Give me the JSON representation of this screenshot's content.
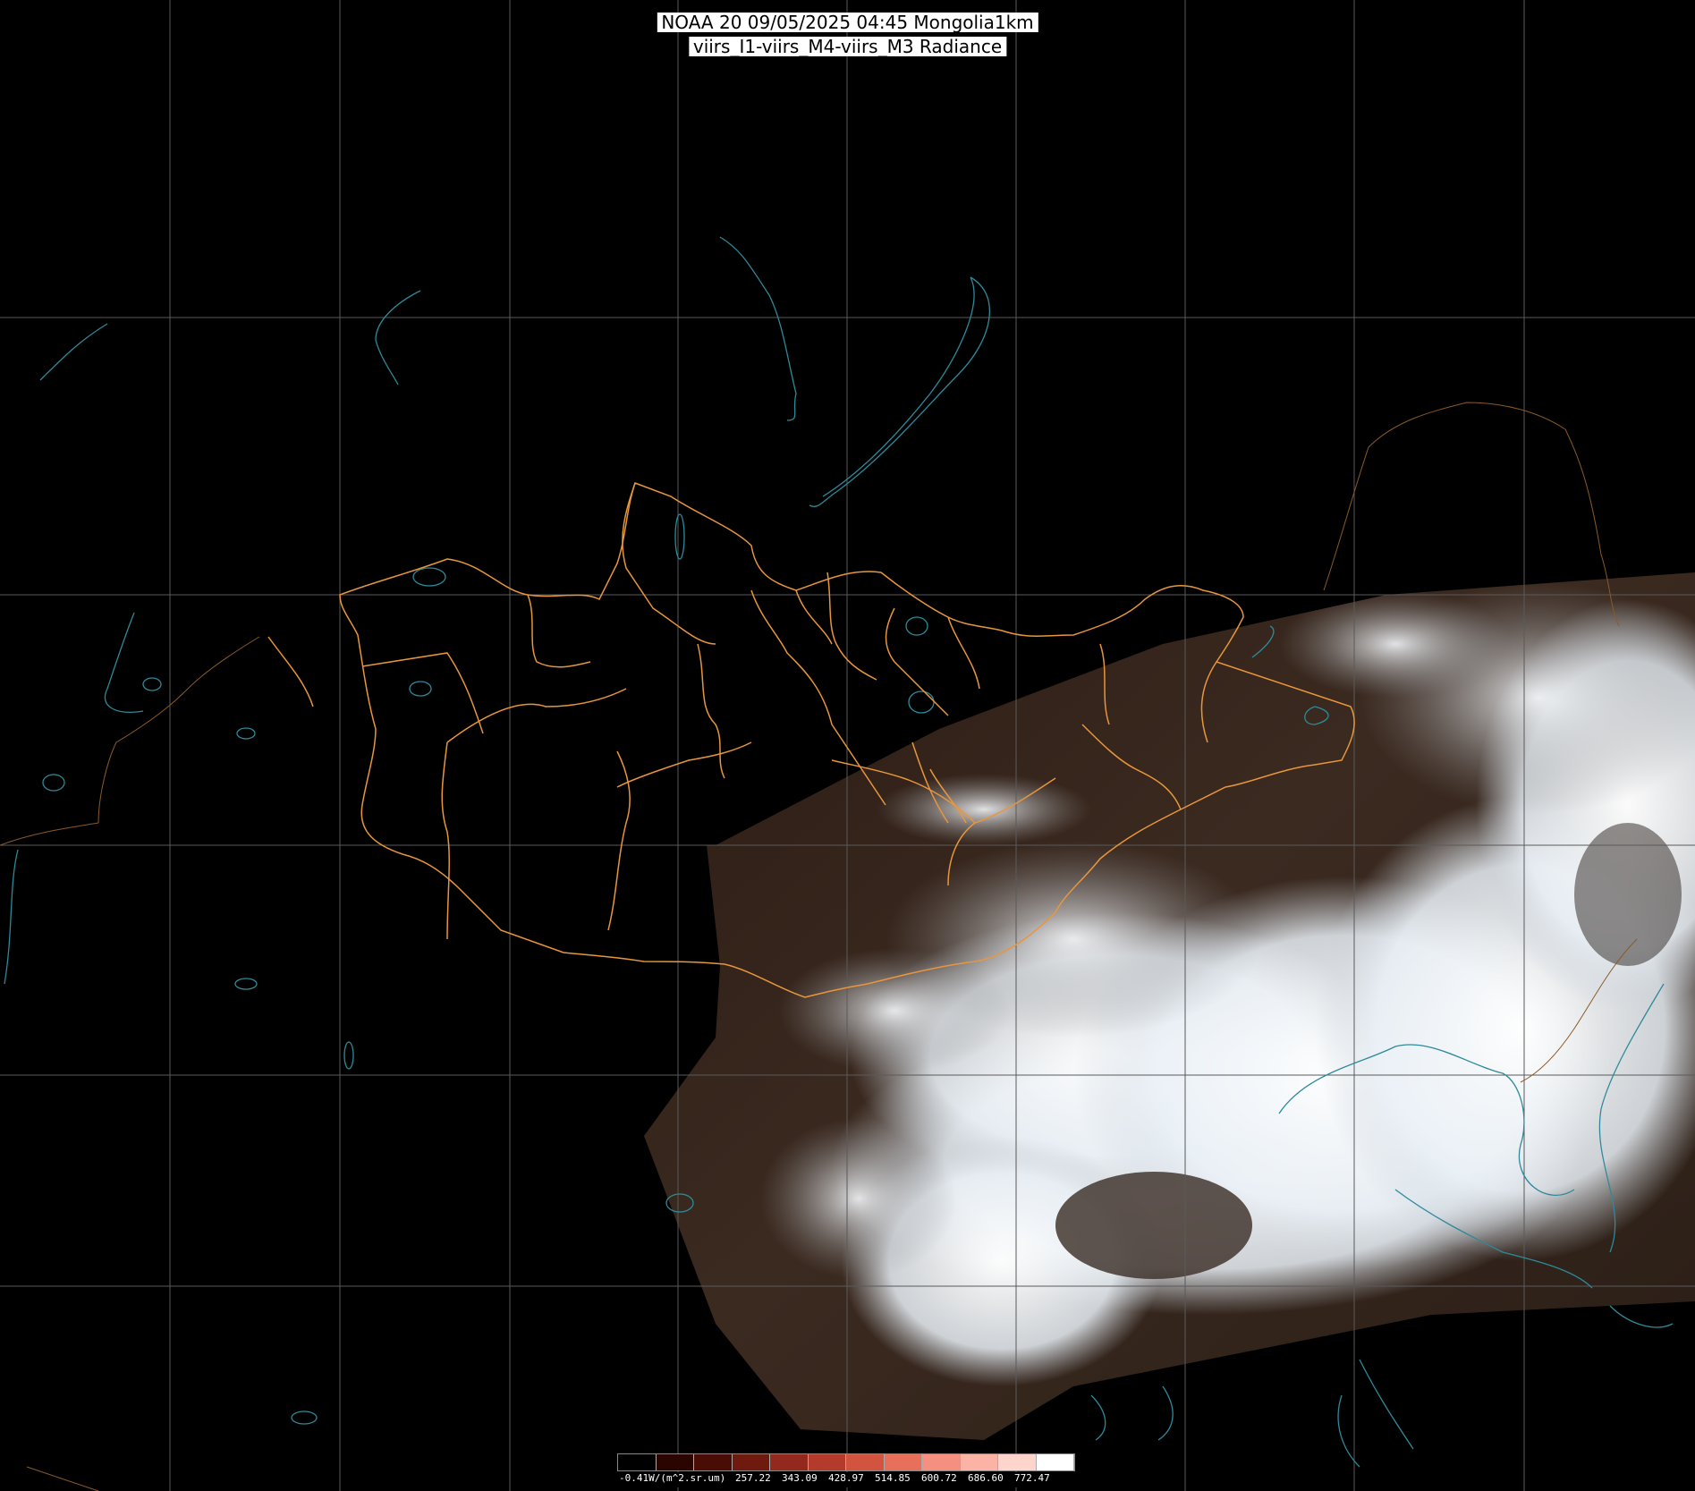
{
  "title": {
    "line1": "NOAA 20 09/05/2025 04:45 Mongolia1km",
    "line2": "viirs_I1-viirs_M4-viirs_M3 Radiance"
  },
  "legend": {
    "min_label": "-0.41W/(m^2.sr.um)",
    "tick_labels": [
      "257.22",
      "343.09",
      "428.97",
      "514.85",
      "600.72",
      "686.60",
      "772.47"
    ],
    "colors": [
      "#000000",
      "#2a0500",
      "#4a0d05",
      "#6e1a0f",
      "#92291c",
      "#b43b2b",
      "#d2543f",
      "#e8705b",
      "#f59080",
      "#fbb3a6",
      "#fdd5cd",
      "#ffffff"
    ]
  },
  "colors": {
    "gridline": "#5a5a5a",
    "border": "#e8963c",
    "coastline": "#2e8a9a",
    "land_dark": "#3a2418",
    "cloud": "#f2f6fa"
  }
}
